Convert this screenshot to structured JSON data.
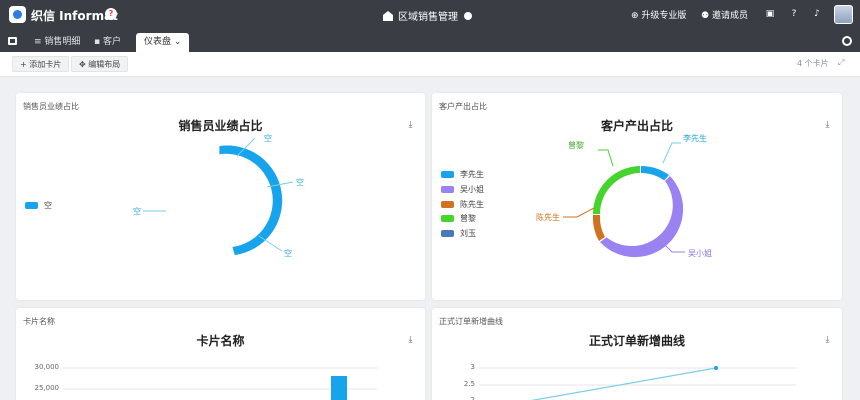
{
  "topbar": {
    "brand": "织信 Informat",
    "app_title": "区域销售管理",
    "upgrade": "升级专业版",
    "invite": "邀请成员"
  },
  "tabs": [
    {
      "label": "≡ 销售明细"
    },
    {
      "label": "客户"
    },
    {
      "label": "仪表盘 ⌄"
    }
  ],
  "toolbar": {
    "add_card": "+ 添加卡片",
    "edit_layout": "编辑布局",
    "right_info": "4 个卡片"
  },
  "cards": {
    "sales_ratio": {
      "label": "销售员业绩占比",
      "title": "销售员业绩占比",
      "legend": "空",
      "callouts": [
        "空",
        "空",
        "空",
        "空"
      ]
    },
    "customer_ratio": {
      "label": "客户产出占比",
      "title": "客户产出占比",
      "legend": [
        "李先生",
        "吴小姐",
        "陈先生",
        "曾黎",
        "刘玉"
      ],
      "callouts": [
        "曾黎",
        "李先生",
        "陈先生",
        "吴小姐"
      ]
    },
    "card_name": {
      "label": "卡片名称",
      "title": "卡片名称"
    },
    "order_trend": {
      "label": "正式订单新增曲线",
      "title": "正式订单新增曲线"
    }
  },
  "colors": {
    "blue": "#18a4ec",
    "purple": "#9a82f2",
    "orange": "#d07320",
    "green": "#45d42c",
    "steel": "#4a78b8",
    "teal": "#79cfe6"
  },
  "chart_data": [
    {
      "type": "pie",
      "title": "销售员业绩占比",
      "labels": [
        "空"
      ],
      "values": [
        100
      ]
    },
    {
      "type": "pie",
      "title": "客户产出占比",
      "labels": [
        "李先生",
        "吴小姐",
        "陈先生",
        "曾黎",
        "刘玉"
      ],
      "values": [
        5,
        55,
        18,
        22,
        0
      ]
    },
    {
      "type": "bar",
      "title": "卡片名称",
      "ytick_labels": [
        "30,000",
        "25,000"
      ],
      "values": [
        27000
      ]
    },
    {
      "type": "line",
      "title": "正式订单新增曲线",
      "ytick_labels": [
        "3",
        "2.5",
        "2"
      ],
      "values": [
        2,
        3
      ]
    }
  ]
}
